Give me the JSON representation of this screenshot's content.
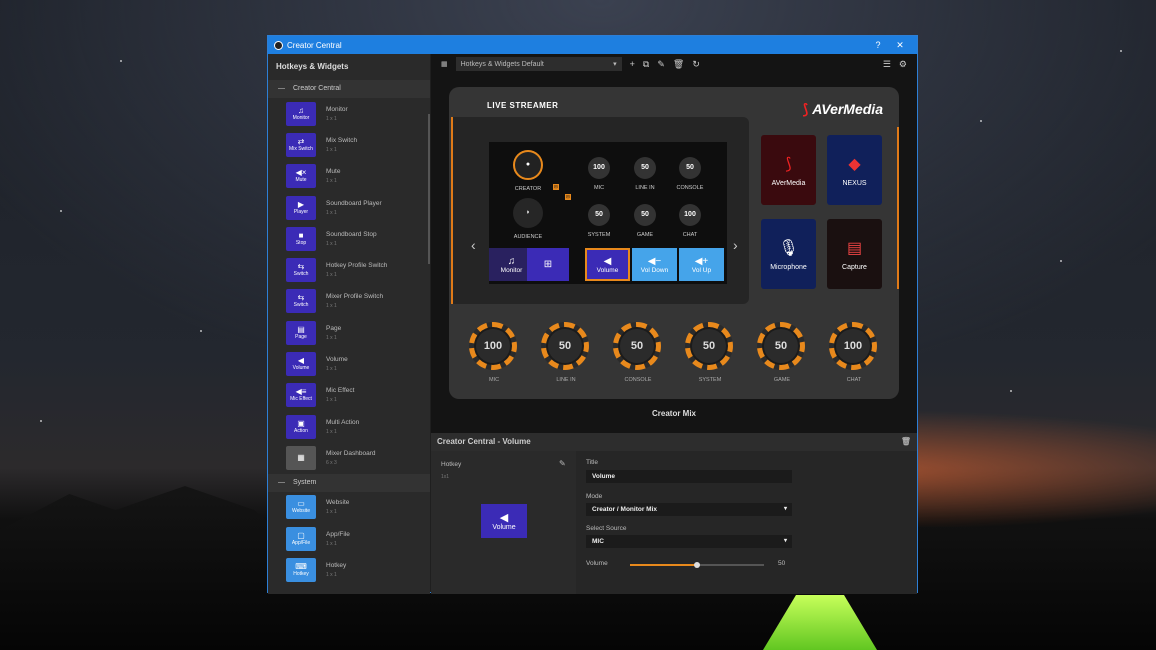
{
  "window": {
    "title": "Creator Central"
  },
  "sidebar": {
    "header": "Hotkeys & Widgets",
    "groups": [
      {
        "label": "Creator Central",
        "items": [
          {
            "icon": "Monitor",
            "label": "Monitor",
            "size": "1 x 1"
          },
          {
            "icon": "Mix Switch",
            "label": "Mix Switch",
            "size": "1 x 1"
          },
          {
            "icon": "Mute",
            "label": "Mute",
            "size": "1 x 1"
          },
          {
            "icon": "Player",
            "label": "Soundboard Player",
            "size": "1 x 1"
          },
          {
            "icon": "Stop",
            "label": "Soundboard Stop",
            "size": "1 x 1"
          },
          {
            "icon": "Switch",
            "label": "Hotkey Profile Switch",
            "size": "1 x 1"
          },
          {
            "icon": "Switch",
            "label": "Mixer Profile Switch",
            "size": "1 x 1"
          },
          {
            "icon": "Page",
            "label": "Page",
            "size": "1 x 1"
          },
          {
            "icon": "Volume",
            "label": "Volume",
            "size": "1 x 1"
          },
          {
            "icon": "Mic Effect",
            "label": "Mic Effect",
            "size": "1 x 1"
          },
          {
            "icon": "Action",
            "label": "Multi Action",
            "size": "1 x 1"
          },
          {
            "icon": "",
            "label": "Mixer Dashboard",
            "size": "6 x 3"
          }
        ]
      },
      {
        "label": "System",
        "items": [
          {
            "icon": "Website",
            "label": "Website",
            "size": "1 x 1"
          },
          {
            "icon": "App/File",
            "label": "App/File",
            "size": "1 x 1"
          },
          {
            "icon": "Hotkey",
            "label": "Hotkey",
            "size": "1 x 1"
          }
        ]
      }
    ]
  },
  "toolbar": {
    "profile": "Hotkeys & Widgets Default"
  },
  "device": {
    "brand_left": "LIVE STREAMER",
    "brand_right": "AVerMedia",
    "channels": [
      {
        "label": "CREATOR"
      },
      {
        "label": "MIC",
        "value": "100"
      },
      {
        "label": "LINE IN",
        "value": "50"
      },
      {
        "label": "CONSOLE",
        "value": "50"
      },
      {
        "label": "AUDIENCE"
      },
      {
        "label": "SYSTEM",
        "value": "50"
      },
      {
        "label": "GAME",
        "value": "50"
      },
      {
        "label": "CHAT",
        "value": "100"
      }
    ],
    "widget_keys": [
      "Monitor",
      "Volume",
      "Vol Down",
      "Vol Up"
    ],
    "tiles": [
      "AVerMedia",
      "NEXUS",
      "Microphone",
      "Capture"
    ],
    "knobs": [
      {
        "value": "100",
        "label": "MIC"
      },
      {
        "value": "50",
        "label": "LINE IN"
      },
      {
        "value": "50",
        "label": "CONSOLE"
      },
      {
        "value": "50",
        "label": "SYSTEM"
      },
      {
        "value": "50",
        "label": "GAME"
      },
      {
        "value": "100",
        "label": "CHAT"
      }
    ],
    "mix_label": "Creator Mix"
  },
  "detail": {
    "header": "Creator Central - Volume",
    "hotkey_label": "Hotkey",
    "hotkey_size": "1x1",
    "preview_label": "Volume",
    "title_label": "Title",
    "title_value": "Volume",
    "mode_label": "Mode",
    "mode_value": "Creator / Monitor Mix",
    "source_label": "Select Source",
    "source_value": "MIC",
    "volume_label": "Volume",
    "volume_value": "50"
  }
}
